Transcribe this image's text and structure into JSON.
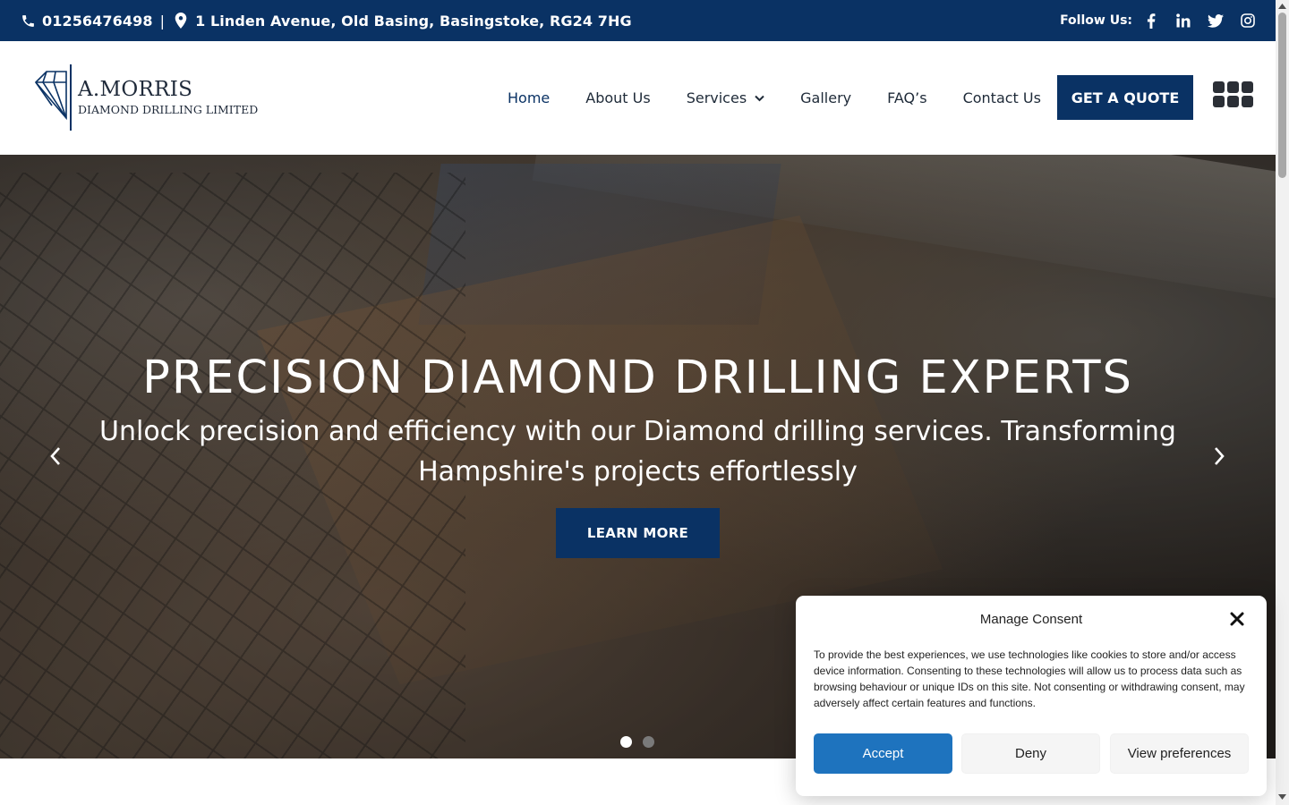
{
  "topbar": {
    "phone": "01256476498",
    "divider": "|",
    "address": "1 Linden Avenue, Old Basing, Basingstoke, RG24 7HG",
    "follow_label": "Follow Us:",
    "social": [
      "facebook-icon",
      "linkedin-icon",
      "twitter-icon",
      "instagram-icon"
    ]
  },
  "logo": {
    "line1": "A.MORRIS",
    "line2": "DIAMOND DRILLING LIMITED"
  },
  "nav": {
    "items": [
      {
        "label": "Home",
        "active": true
      },
      {
        "label": "About Us"
      },
      {
        "label": "Services",
        "has_dropdown": true
      },
      {
        "label": "Gallery"
      },
      {
        "label": "FAQ’s"
      },
      {
        "label": "Contact Us"
      }
    ],
    "quote_button": "GET A QUOTE"
  },
  "hero": {
    "title": "PRECISION DIAMOND DRILLING EXPERTS",
    "subtitle": "Unlock precision and efficiency with our Diamond drilling services. Transforming Hampshire's projects effortlessly",
    "button": "LEARN MORE",
    "slides_total": 2,
    "active_slide": 1
  },
  "consent": {
    "title": "Manage Consent",
    "text": "To provide the best experiences, we use technologies like cookies to store and/or access device information. Consenting to these technologies will allow us to process data such as browsing behaviour or unique IDs on this site. Not consenting or withdrawing consent, may adversely affect certain features and functions.",
    "accept": "Accept",
    "deny": "Deny",
    "preferences": "View preferences"
  },
  "colors": {
    "brand_navy": "#0a3264",
    "accept_blue": "#1e73be",
    "dot_active": "#ffffff",
    "dot_inactive": "#7a7a7a"
  }
}
